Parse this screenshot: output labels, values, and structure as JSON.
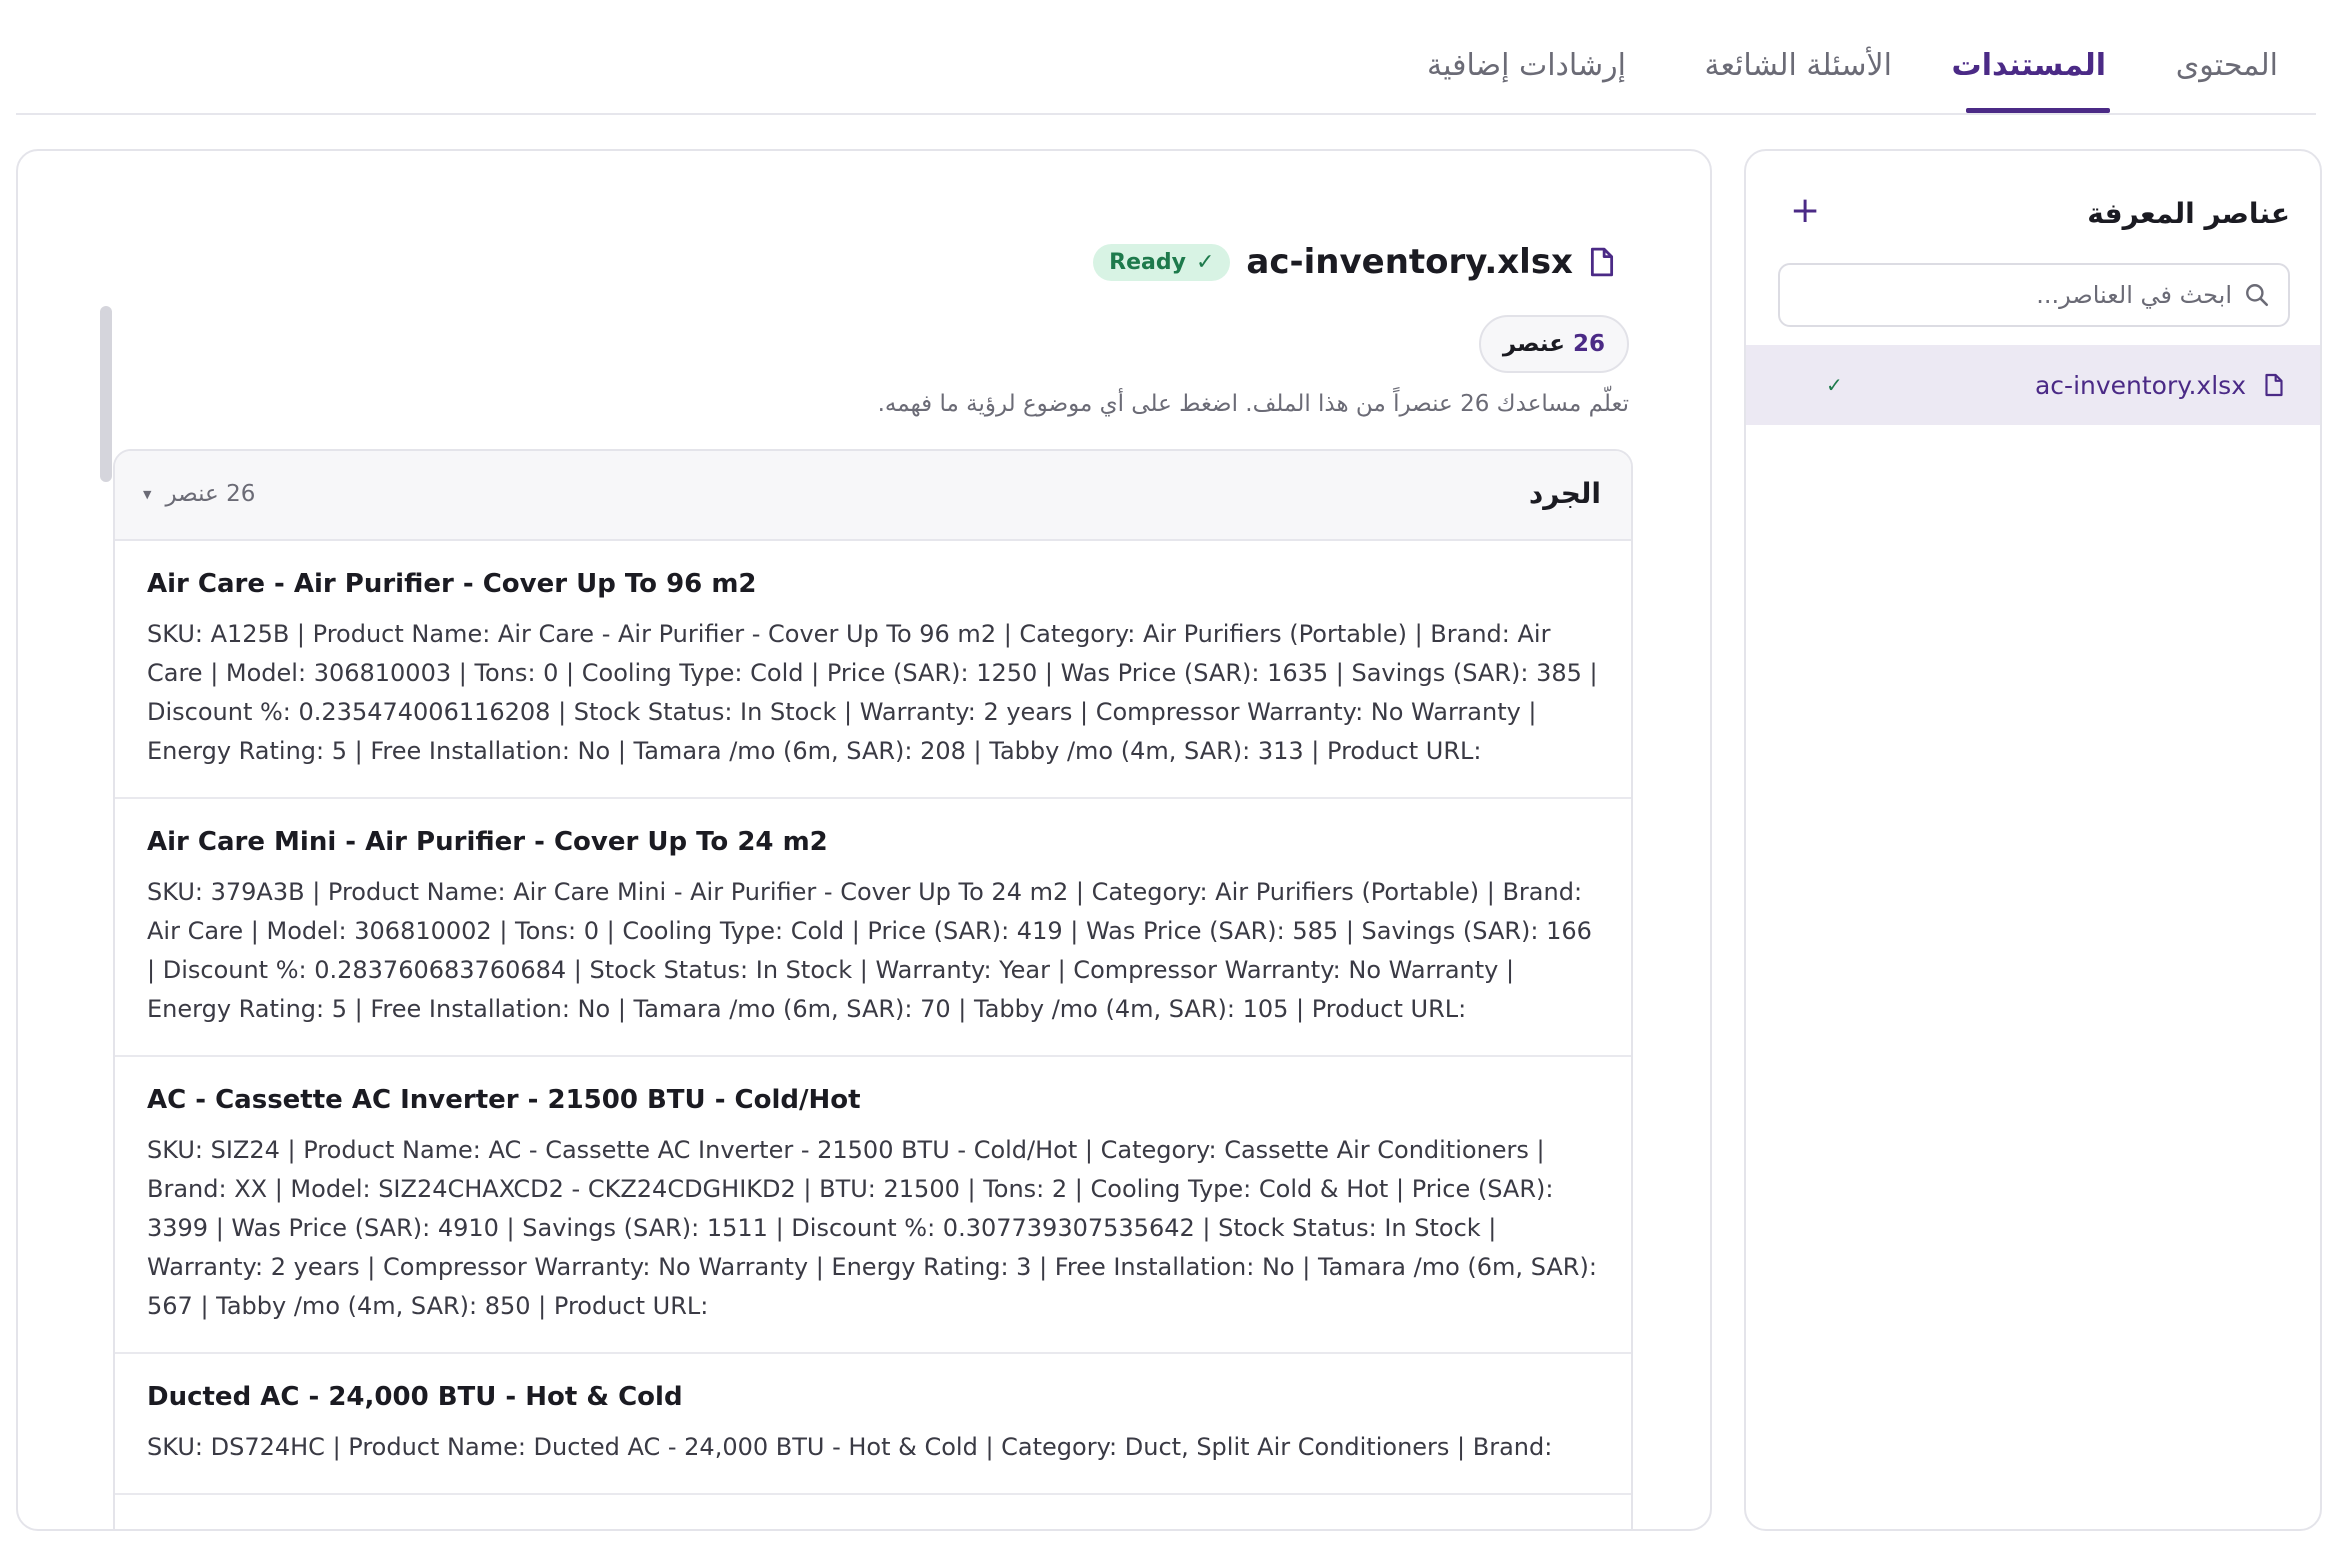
{
  "tabs": [
    {
      "label": "المحتوى"
    },
    {
      "label": "المستندات"
    },
    {
      "label": "الأسئلة الشائعة"
    },
    {
      "label": "إرشادات إضافية"
    }
  ],
  "document": {
    "title": "ac-inventory.xlsx",
    "status": "Ready",
    "item_count_number": "26",
    "item_count_label": "عنصر",
    "description": "تعلّم مساعدك 26 عنصراً من هذا الملف. اضغط على أي موضوع لرؤية ما فهمه."
  },
  "group": {
    "title": "الجرد",
    "count_label": "26 عنصر",
    "items": [
      {
        "title": "Air Care - Air Purifier - Cover Up To 96 m2",
        "body": "SKU: A125B | Product Name: Air Care - Air Purifier - Cover Up To 96 m2 | Category: Air Purifiers (Portable) | Brand: Air Care | Model: 306810003 | Tons: 0 | Cooling Type: Cold | Price (SAR): 1250 | Was Price (SAR): 1635 | Savings (SAR): 385 | Discount %: 0.235474006116208 | Stock Status: In Stock | Warranty: 2 years | Compressor Warranty: No Warranty | Energy Rating: 5 | Free Installation: No | Tamara /mo (6m, SAR): 208 | Tabby /mo (4m, SAR): 313 | Product URL:"
      },
      {
        "title": "Air Care Mini - Air Purifier - Cover Up To 24 m2",
        "body": "SKU: 379A3B | Product Name: Air Care Mini - Air Purifier - Cover Up To 24 m2 | Category: Air Purifiers (Portable) | Brand: Air Care | Model: 306810002 | Tons: 0 | Cooling Type: Cold | Price (SAR): 419 | Was Price (SAR): 585 | Savings (SAR): 166 | Discount %: 0.283760683760684 | Stock Status: In Stock | Warranty: Year | Compressor Warranty: No Warranty | Energy Rating: 5 | Free Installation: No | Tamara /mo (6m, SAR): 70 | Tabby /mo (4m, SAR): 105 | Product URL:"
      },
      {
        "title": "AC - Cassette AC Inverter - 21500 BTU - Cold/Hot",
        "body": "SKU: SIZ24 | Product Name: AC - Cassette AC Inverter - 21500 BTU - Cold/Hot | Category: Cassette Air Conditioners | Brand: XX | Model: SIZ24CHAXCD2 - CKZ24CDGHIKD2 | BTU: 21500 | Tons: 2 | Cooling Type: Cold & Hot | Price (SAR): 3399 | Was Price (SAR): 4910 | Savings (SAR): 1511 | Discount %: 0.307739307535642 | Stock Status: In Stock | Warranty: 2 years | Compressor Warranty: No Warranty | Energy Rating: 3 | Free Installation: No | Tamara /mo (6m, SAR): 567 | Tabby /mo (4m, SAR): 850 | Product URL:"
      },
      {
        "title": "Ducted AC - 24,000 BTU - Hot & Cold",
        "body": "SKU: DS724HC | Product Name: Ducted AC - 24,000 BTU - Hot & Cold | Category: Duct, Split Air Conditioners | Brand:"
      }
    ]
  },
  "sidebar": {
    "title": "عناصر المعرفة",
    "add_label": "+",
    "search_placeholder": "ابحث في العناصر...",
    "files": [
      {
        "name": "ac-inventory.xlsx",
        "status_icon": "check-icon"
      }
    ]
  },
  "colors": {
    "accent": "#4b2a86",
    "ready_bg": "#d8f3e4",
    "ready_fg": "#1e7a4c",
    "selected_bg": "#ece9f3"
  }
}
